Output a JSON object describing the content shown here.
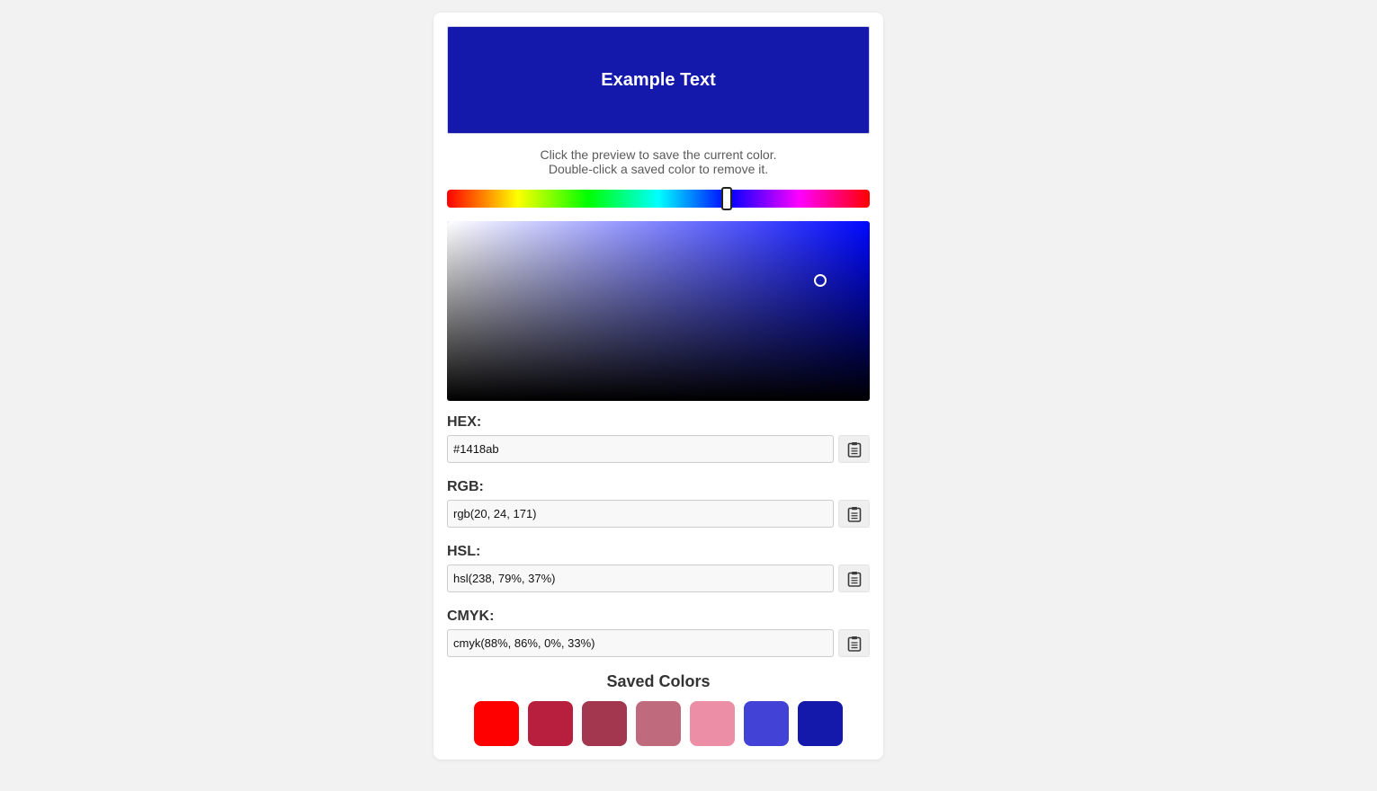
{
  "preview": {
    "text": "Example Text",
    "color": "#1418ab"
  },
  "instructions": {
    "line1": "Click the preview to save the current color.",
    "line2": "Double-click a saved color to remove it."
  },
  "picker": {
    "hue": 238,
    "saturation": 0.88,
    "value": 0.67,
    "hue_color": "#0008ff"
  },
  "fields": {
    "hex": {
      "label": "HEX:",
      "value": "#1418ab",
      "copy_icon": "clipboard-icon"
    },
    "rgb": {
      "label": "RGB:",
      "value": "rgb(20, 24, 171)",
      "copy_icon": "clipboard-icon"
    },
    "hsl": {
      "label": "HSL:",
      "value": "hsl(238, 79%, 37%)",
      "copy_icon": "clipboard-icon"
    },
    "cmyk": {
      "label": "CMYK:",
      "value": "cmyk(88%, 86%, 0%, 33%)",
      "copy_icon": "clipboard-icon"
    }
  },
  "saved": {
    "title": "Saved Colors",
    "colors": [
      "#ff0000",
      "#b81f3f",
      "#a2374f",
      "#bf6b7d",
      "#ec8ea6",
      "#4243d6",
      "#1418ab"
    ]
  }
}
